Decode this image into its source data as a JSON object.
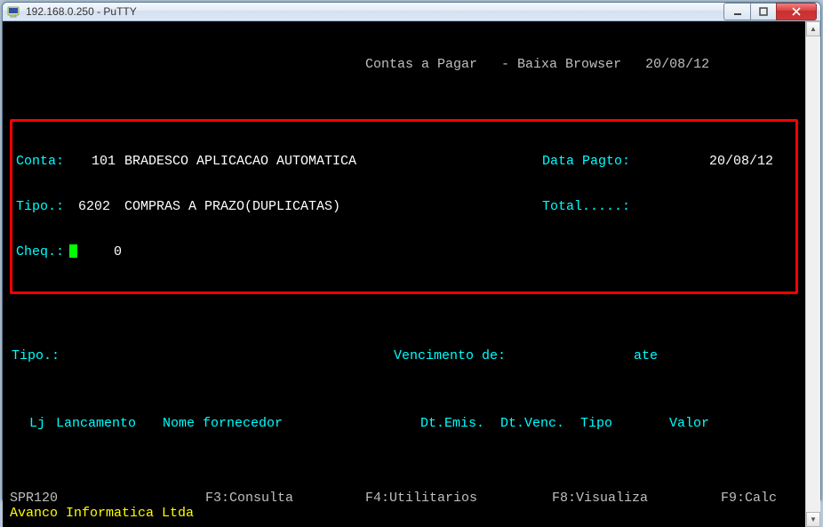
{
  "window": {
    "title": "192.168.0.250 - PuTTY"
  },
  "header": {
    "app": "Contas a Pagar",
    "mode": "- Baixa Browser",
    "date": "20/08/12"
  },
  "form": {
    "conta_label": "Conta:",
    "conta_code": "101",
    "conta_name": "BRADESCO APLICACAO AUTOMATICA",
    "data_pagto_label": "Data Pagto:",
    "data_pagto_value": "20/08/12",
    "tipo_label": "Tipo.:",
    "tipo_code": "6202",
    "tipo_name": "COMPRAS A PRAZO(DUPLICATAS)",
    "total_label": "Total.....:",
    "cheq_label": "Cheq.:",
    "cheq_value": "0"
  },
  "filter": {
    "tipo_label": "Tipo.:",
    "venc_label": "Vencimento de:",
    "ate_label": "ate"
  },
  "columns": {
    "lj": "Lj",
    "lancamento": "Lancamento",
    "fornecedor": "Nome fornecedor",
    "emis": "Dt.Emis.",
    "venc": "Dt.Venc.",
    "tipo": "Tipo",
    "valor": "Valor"
  },
  "footer": {
    "prog": "SPR120",
    "f3": "F3:Consulta",
    "f4": "F4:Utilitarios",
    "f8": "F8:Visualiza",
    "f9": "F9:Calc",
    "company": "Avanco Informatica Ltda"
  }
}
